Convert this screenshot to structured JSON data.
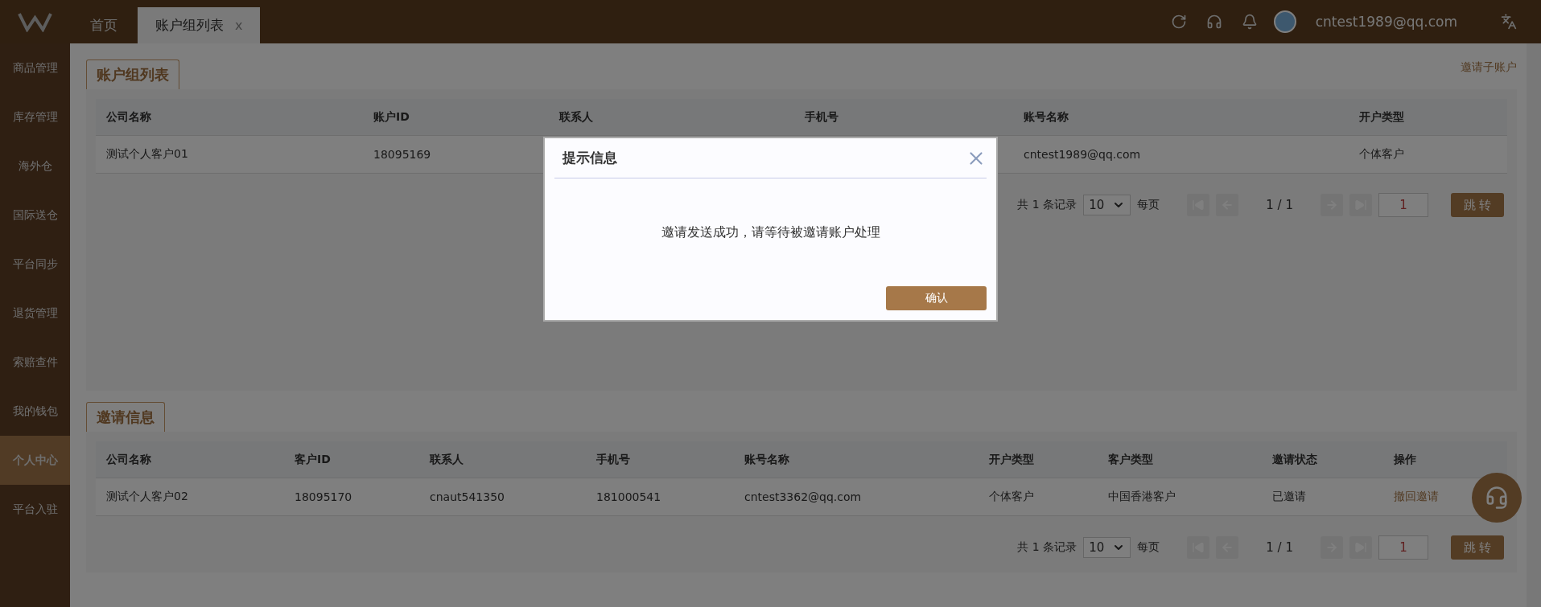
{
  "header": {
    "tabs": [
      {
        "label": "首页",
        "selected": false,
        "closable": false
      },
      {
        "label": "账户组列表",
        "selected": true,
        "closable": true
      }
    ],
    "close_mark": "x",
    "user": "cntest1989@qq.com"
  },
  "sidebar": {
    "items": [
      {
        "label": "商品管理",
        "selected": false
      },
      {
        "label": "库存管理",
        "selected": false
      },
      {
        "label": "海外仓",
        "selected": false
      },
      {
        "label": "国际送仓",
        "selected": false
      },
      {
        "label": "平台同步",
        "selected": false
      },
      {
        "label": "退货管理",
        "selected": false
      },
      {
        "label": "索赔查件",
        "selected": false
      },
      {
        "label": "我的钱包",
        "selected": false
      },
      {
        "label": "个人中心",
        "selected": true
      },
      {
        "label": "平台入驻",
        "selected": false
      }
    ]
  },
  "panels": [
    {
      "title": "账户组列表",
      "action": "邀请子账户",
      "columns": [
        "公司名称",
        "账户ID",
        "联系人",
        "手机号",
        "账号名称",
        "开户类型"
      ],
      "rows": [
        {
          "cells": [
            {
              "text": "测试个人客户01",
              "kind": "text"
            },
            {
              "text": "18095169",
              "kind": "text"
            },
            null,
            null,
            {
              "text": "cntest1989@qq.com",
              "kind": "text"
            },
            {
              "text": "个体客户",
              "kind": "text"
            }
          ]
        }
      ],
      "pagination": {
        "total": "共 1 条记录",
        "page_size": "10",
        "per_page": "每页",
        "page": "1 / 1",
        "jump_value": "1",
        "jump": "跳 转"
      }
    },
    {
      "title": "邀请信息",
      "columns": [
        "公司名称",
        "客户ID",
        "联系人",
        "手机号",
        "账号名称",
        "开户类型",
        "客户类型",
        "邀请状态",
        "操作"
      ],
      "rows": [
        {
          "cells": [
            {
              "text": "测试个人客户02",
              "kind": "text"
            },
            {
              "text": "18095170",
              "kind": "text"
            },
            {
              "text": "cnaut541350",
              "kind": "text"
            },
            {
              "text": "181000541",
              "kind": "text"
            },
            {
              "text": "cntest3362@qq.com",
              "kind": "text"
            },
            {
              "text": "个体客户",
              "kind": "text"
            },
            {
              "text": "中国香港客户",
              "kind": "text"
            },
            {
              "text": "已邀请",
              "kind": "text"
            },
            {
              "text": "撤回邀请",
              "kind": "link"
            }
          ]
        }
      ],
      "pagination": {
        "total": "共 1 条记录",
        "page_size": "10",
        "per_page": "每页",
        "page": "1 / 1",
        "jump_value": "1",
        "jump": "跳 转"
      }
    }
  ],
  "dialog": {
    "title": "提示信息",
    "message": "邀请发送成功，请等待被邀请账户处理",
    "confirm": "确认"
  }
}
